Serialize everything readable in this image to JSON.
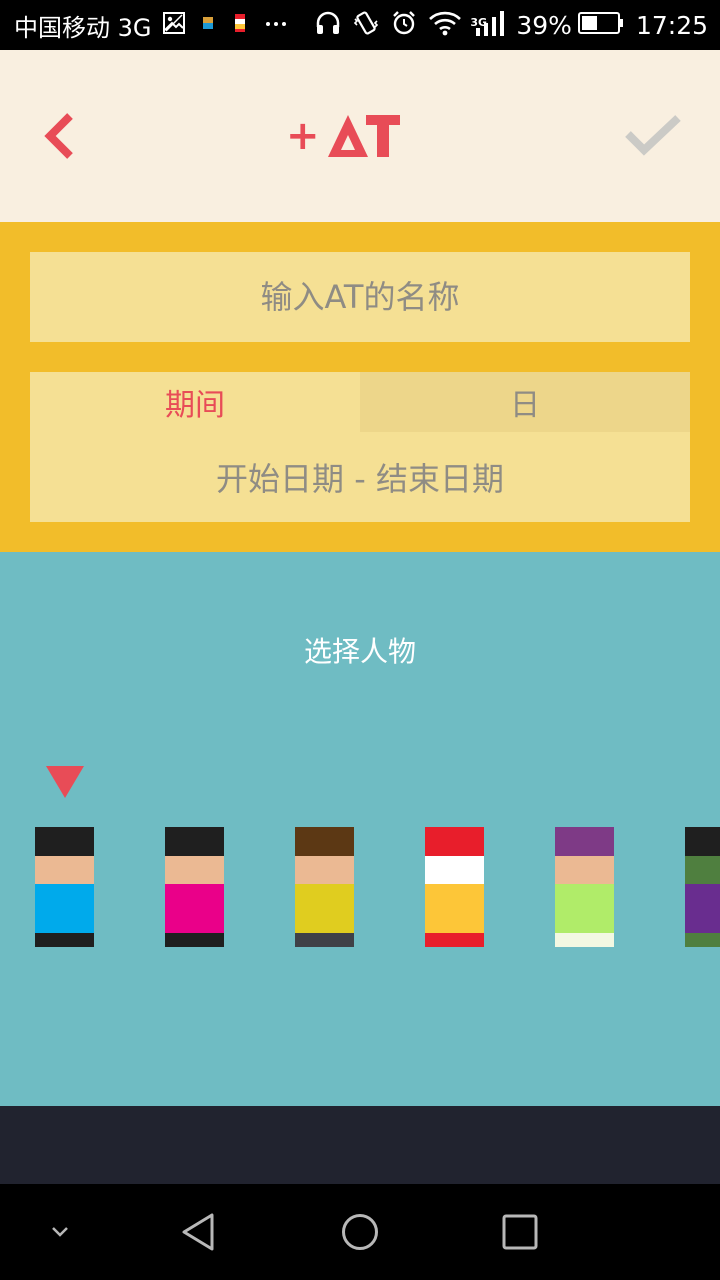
{
  "status_bar": {
    "carrier": "中国移动 3G",
    "network_type": "3G",
    "battery": "39%",
    "time": "17:25",
    "icons": [
      "gallery-icon",
      "notification-app-icon",
      "notification-app-icon",
      "more-dots-icon",
      "headphones-icon",
      "vibrate-icon",
      "alarm-icon",
      "wifi-icon",
      "signal-icon",
      "battery-icon"
    ]
  },
  "header": {
    "logo_plus": "+",
    "logo_text": "AT",
    "back_icon": "chevron-left-icon",
    "confirm_icon": "checkmark-icon"
  },
  "form": {
    "name_placeholder": "输入AT的名称",
    "tabs": [
      {
        "label": "期间",
        "selected": true
      },
      {
        "label": "日",
        "selected": false
      }
    ],
    "date_range_placeholder": "开始日期 - 结束日期"
  },
  "characters": {
    "title": "选择人物",
    "selected_index": 0,
    "items": [
      {
        "hair": "#1f1f1f",
        "face": "#ebb993",
        "body": "#00aaeb",
        "feet": "#1f1f1f"
      },
      {
        "hair": "#1f1f1f",
        "face": "#ebb993",
        "body": "#ea0089",
        "feet": "#1f1f1f"
      },
      {
        "hair": "#5c3814",
        "face": "#ebb993",
        "body": "#e0cd1f",
        "feet": "#3f4147"
      },
      {
        "hair": "#e81e2b",
        "face": "#ffffff",
        "body": "#fdc638",
        "feet": "#e81e2b"
      },
      {
        "hair": "#7e3a86",
        "face": "#ebb993",
        "body": "#b0ec69",
        "feet": "#f3f8e2"
      },
      {
        "hair": "#1f1f1f",
        "face": "#4f7f3f",
        "body": "#692d8f",
        "feet": "#4f7f3f"
      }
    ]
  },
  "colors": {
    "accent": "#e84c57",
    "header_bg": "#f9efe0",
    "form_bg": "#f2bd2a",
    "field_bg": "#f5e094",
    "char_panel_bg": "#6fbcc3",
    "bottom_bar_bg": "#21232f"
  }
}
